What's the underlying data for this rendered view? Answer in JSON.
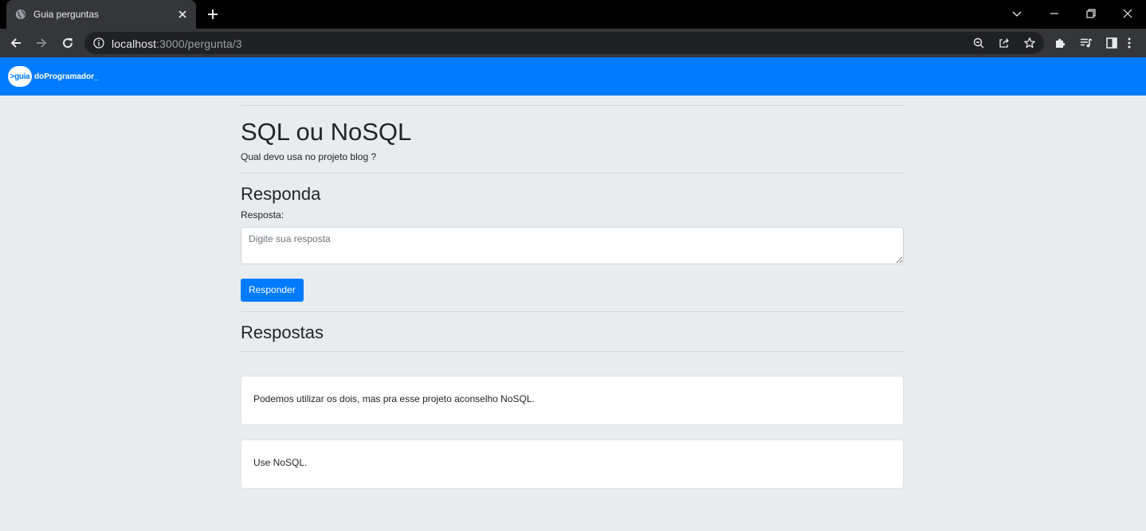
{
  "browser": {
    "tab_title": "Guia perguntas",
    "url_host": "localhost",
    "url_path": ":3000/pergunta/3"
  },
  "icons": {
    "favicon": "globe-icon",
    "tab_close": "close-icon",
    "new_tab": "plus-icon",
    "tab_search": "chevron-down-icon",
    "minimize": "minimize-icon",
    "restore": "restore-icon",
    "close_window": "close-icon",
    "back": "arrow-left-icon",
    "forward": "arrow-right-icon",
    "reload": "reload-icon",
    "site_info": "info-icon",
    "zoom": "zoom-out-icon",
    "share": "share-icon",
    "bookmark": "star-icon",
    "extensions": "puzzle-icon",
    "media": "playlist-icon",
    "side_panel": "side-panel-icon",
    "menu": "kebab-menu-icon"
  },
  "navbar": {
    "brand_badge": ">guia",
    "brand_text": "doProgramador_"
  },
  "question": {
    "title": "SQL ou NoSQL",
    "description": "Qual devo usa no projeto blog ?"
  },
  "answer_form": {
    "heading": "Responda",
    "label": "Resposta:",
    "placeholder": "Digite sua resposta",
    "value": "",
    "submit_label": "Responder"
  },
  "answers_section": {
    "heading": "Respostas",
    "items": [
      {
        "text": "Podemos utilizar os dois, mas pra esse projeto aconselho NoSQL."
      },
      {
        "text": "Use NoSQL."
      }
    ]
  },
  "colors": {
    "primary": "#007bff",
    "page_background": "#e9ecef",
    "chrome_dark": "#35363a"
  }
}
